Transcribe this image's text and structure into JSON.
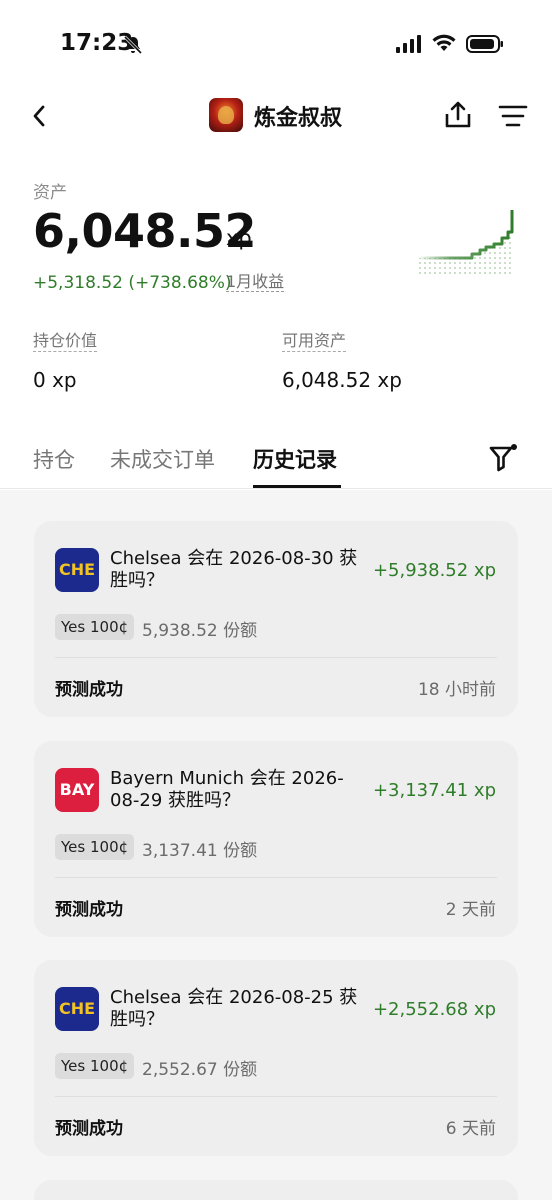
{
  "status": {
    "time": "17:23"
  },
  "header": {
    "username": "炼金叔叔"
  },
  "icons": {
    "back": "chevron-left-icon",
    "share": "share-icon",
    "menu": "menu-icon",
    "filter": "filter-icon",
    "bell": "bell-off-icon"
  },
  "colors": {
    "gain": "#2f7d2a",
    "che_badge": "#1b2a8c",
    "che_text": "#f2c322",
    "bay_badge": "#dc1f3f"
  },
  "assets": {
    "label": "资产",
    "value": "6,048.52",
    "unit": "xp",
    "gain": "+5,318.52 (+738.68%)",
    "period": "1月收益"
  },
  "holdings": {
    "position_label": "持仓价值",
    "position_value": "0 xp",
    "available_label": "可用资产",
    "available_value": "6,048.52 xp"
  },
  "tabs": [
    {
      "label": "持仓"
    },
    {
      "label": "未成交订单"
    },
    {
      "label": "历史记录"
    }
  ],
  "history": [
    {
      "badge": "CHE",
      "title": "Chelsea 会在 2026-08-30 获胜吗？",
      "amount": "+5,938.52 xp",
      "chip": "Yes 100¢",
      "shares": "5,938.52 份额",
      "result": "预测成功",
      "ago": "18 小时前"
    },
    {
      "badge": "BAY",
      "title": "Bayern Munich 会在 2026-08-29 获胜吗？",
      "amount": "+3,137.41 xp",
      "chip": "Yes 100¢",
      "shares": "3,137.41 份额",
      "result": "预测成功",
      "ago": "2 天前"
    },
    {
      "badge": "CHE",
      "title": "Chelsea 会在 2026-08-25 获胜吗？",
      "amount": "+2,552.68 xp",
      "chip": "Yes 100¢",
      "shares": "2,552.67 份额",
      "result": "预测成功",
      "ago": "6 天前"
    }
  ]
}
